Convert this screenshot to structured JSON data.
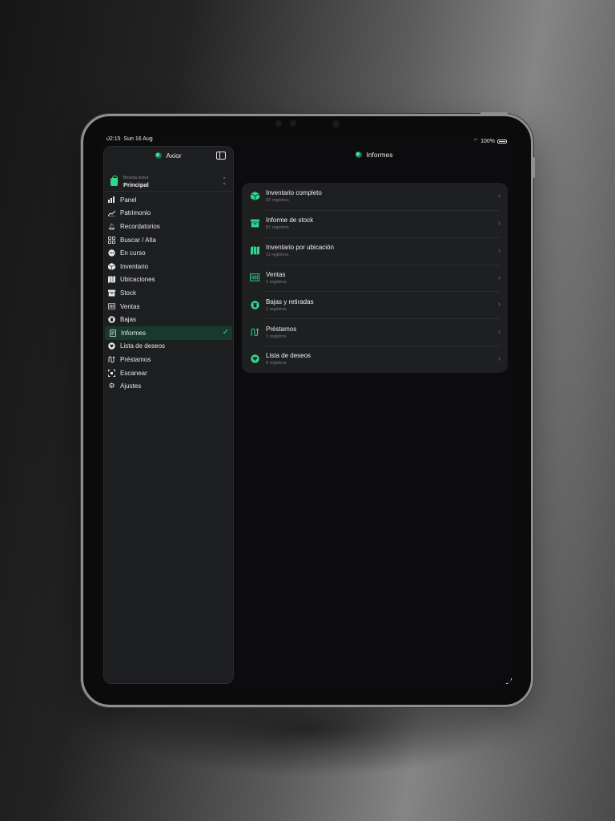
{
  "status_bar": {
    "time": "02:15",
    "date": "Sun 16 Aug",
    "battery": "100%"
  },
  "sidebar": {
    "app_name": "Axior",
    "vault": {
      "label": "Bóveda activa",
      "name": "Principal"
    },
    "items": [
      {
        "label": "Panel",
        "icon": "bar-chart-icon"
      },
      {
        "label": "Patrimonio",
        "icon": "line-chart-icon"
      },
      {
        "label": "Recordatorios",
        "icon": "bell-icon"
      },
      {
        "label": "Buscar / Alta",
        "icon": "grid-icon"
      },
      {
        "label": "En curso",
        "icon": "in-progress-icon"
      },
      {
        "label": "Inventario",
        "icon": "box-icon"
      },
      {
        "label": "Ubicaciones",
        "icon": "map-icon"
      },
      {
        "label": "Stock",
        "icon": "archive-icon"
      },
      {
        "label": "Ventas",
        "icon": "barcode-icon"
      },
      {
        "label": "Bajas",
        "icon": "trash-icon"
      },
      {
        "label": "Informes",
        "icon": "report-icon"
      },
      {
        "label": "Lista de deseos",
        "icon": "heart-icon"
      },
      {
        "label": "Préstamos",
        "icon": "loan-icon"
      },
      {
        "label": "Escanear",
        "icon": "scan-icon"
      },
      {
        "label": "Ajustes",
        "icon": "gear-icon"
      }
    ],
    "active_item": "Informes"
  },
  "main": {
    "title": "Informes",
    "reports": [
      {
        "title": "Inventario completo",
        "subtitle": "87 registros",
        "icon": "box-icon"
      },
      {
        "title": "Informe de stock",
        "subtitle": "87 registros",
        "icon": "archive-icon"
      },
      {
        "title": "Inventario por ubicación",
        "subtitle": "11 registros",
        "icon": "map-icon"
      },
      {
        "title": "Ventas",
        "subtitle": "1 registros",
        "icon": "barcode-icon"
      },
      {
        "title": "Bajas y retiradas",
        "subtitle": "1 registros",
        "icon": "trash-icon"
      },
      {
        "title": "Préstamos",
        "subtitle": "1 registros",
        "icon": "loan-icon"
      },
      {
        "title": "Lista de deseos",
        "subtitle": "0 registros",
        "icon": "heart-icon"
      }
    ]
  },
  "colors": {
    "accent": "#2fd68c",
    "background": "#0c0c0e",
    "card": "#1e1f21",
    "sidebar": "#1d1e20",
    "active_row": "#173a2c"
  }
}
